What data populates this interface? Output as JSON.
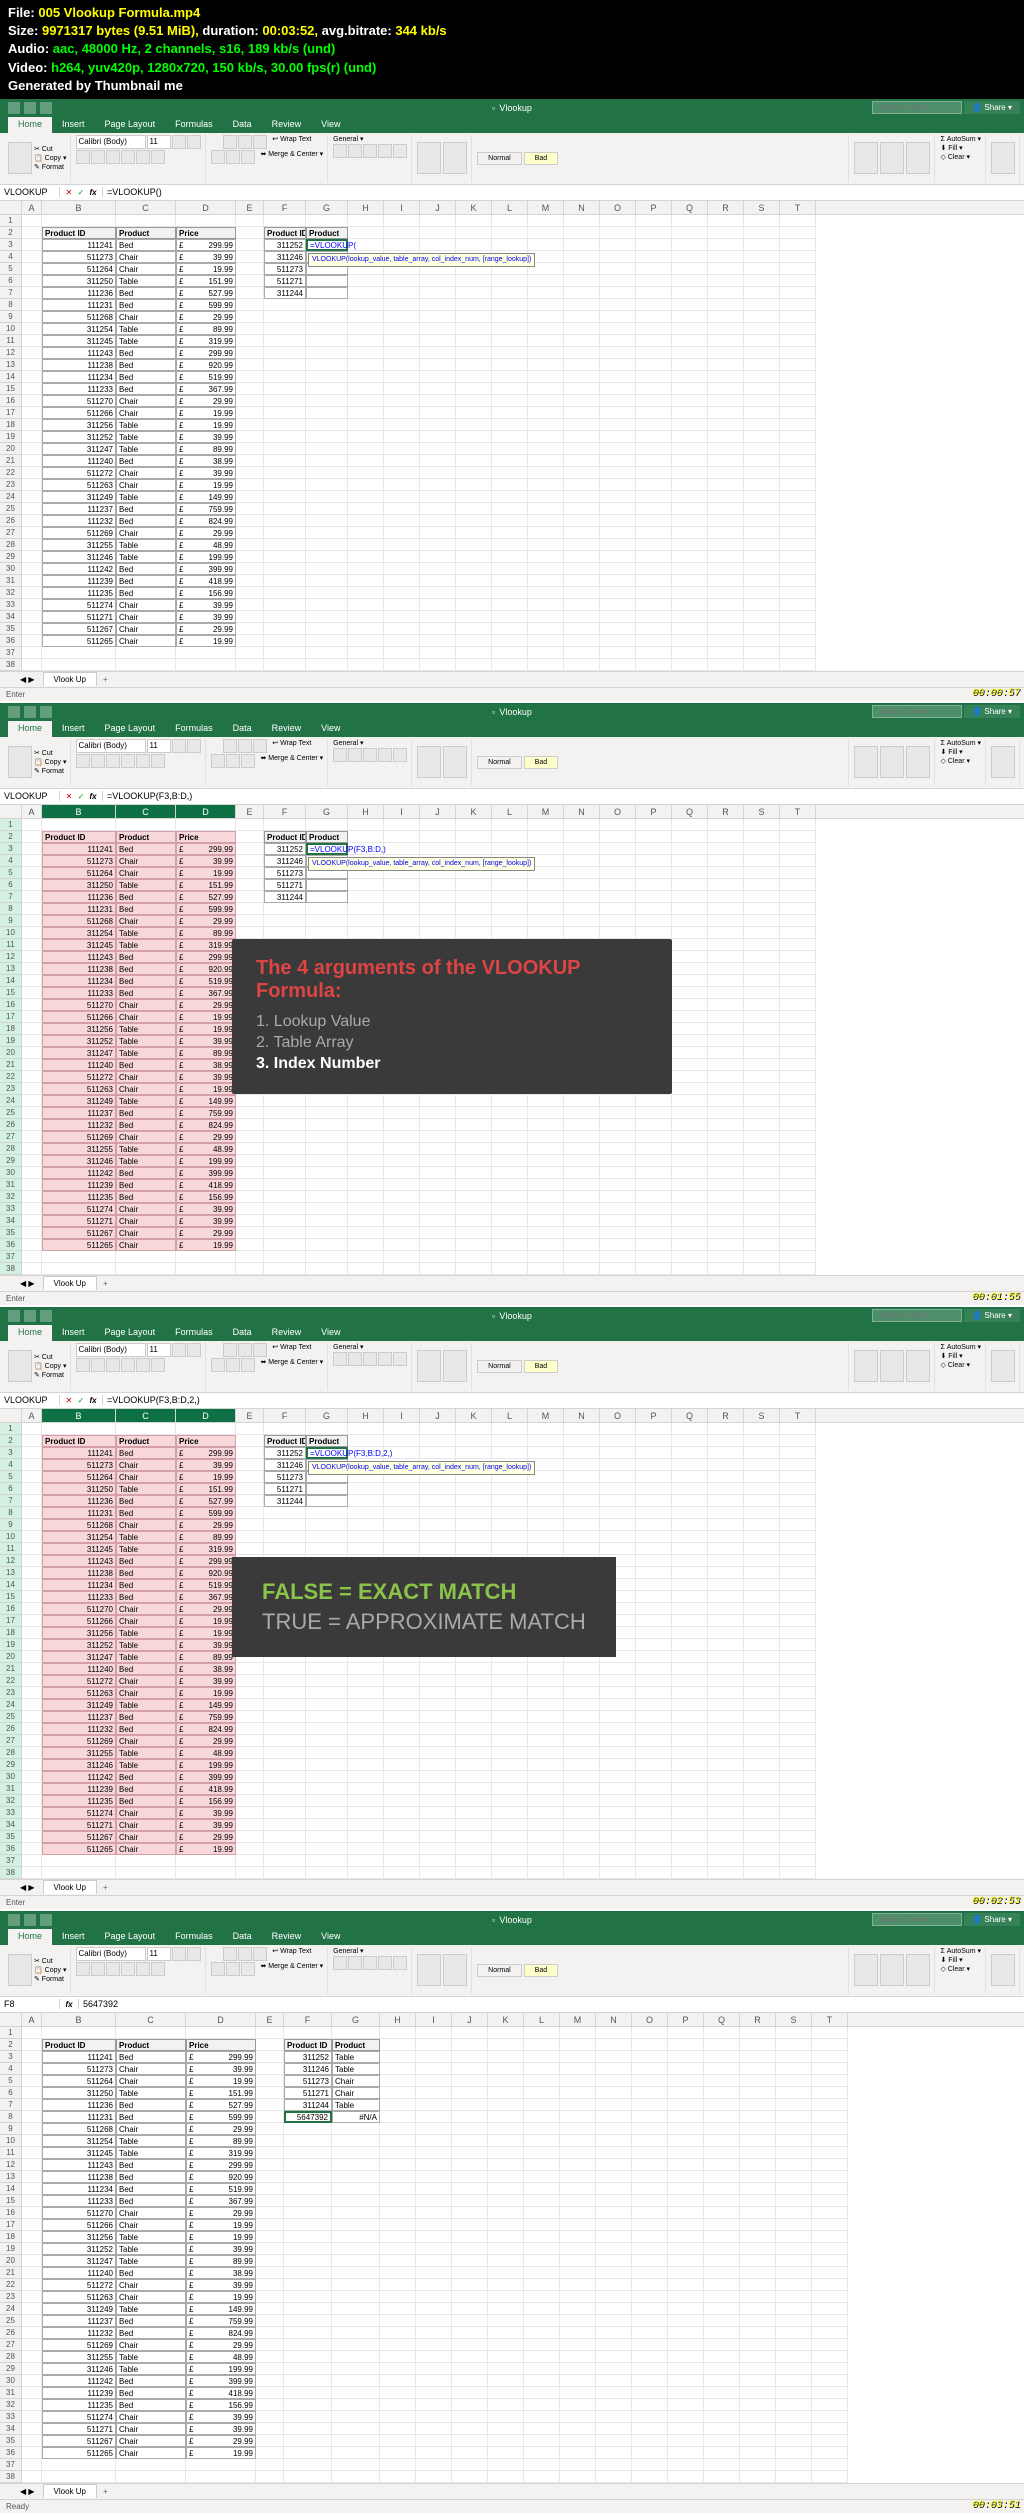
{
  "meta": {
    "file_label": "File:",
    "file": "005 Vlookup Formula.mp4",
    "size_label": "Size:",
    "size": "9971317 bytes (9.51 MiB),",
    "dur_label": "duration:",
    "dur": "00:03:52,",
    "bitrate_label": "avg.bitrate:",
    "bitrate": "344 kb/s",
    "audio_label": "Audio:",
    "audio": "aac, 48000 Hz, 2 channels, s16, 189 kb/s (und)",
    "video_label": "Video:",
    "video": "h264, yuv420p, 1280x720, 150 kb/s, 30.00 fps(r) (und)",
    "gen": "Generated by Thumbnail me"
  },
  "app": {
    "title": "Vlookup",
    "search_placeholder": "Search Sheet",
    "share": "Share",
    "tabs": [
      "Home",
      "Insert",
      "Page Layout",
      "Formulas",
      "Data",
      "Review",
      "View"
    ],
    "font": "Calibri (Body)",
    "size": "11",
    "sheet_tab": "Vlook Up",
    "status_enter": "Enter",
    "status_ready": "Ready",
    "autosum": "AutoSum"
  },
  "cols": {
    "A": 20,
    "B": 74,
    "C": 60,
    "D": 60,
    "E": 28,
    "F": 42,
    "G": 42,
    "def": 36
  },
  "letters": [
    "A",
    "B",
    "C",
    "D",
    "E",
    "F",
    "G",
    "H",
    "I",
    "J",
    "K",
    "L",
    "M",
    "N",
    "O",
    "P",
    "Q",
    "R",
    "S",
    "T"
  ],
  "headers": {
    "pid": "Product ID",
    "prod": "Product",
    "price": "Price"
  },
  "table_data": [
    [
      111241,
      "Bed",
      "£",
      299.99
    ],
    [
      511273,
      "Chair",
      "£",
      39.99
    ],
    [
      511264,
      "Chair",
      "£",
      19.99
    ],
    [
      311250,
      "Table",
      "£",
      151.99
    ],
    [
      111236,
      "Bed",
      "£",
      527.99
    ],
    [
      111231,
      "Bed",
      "£",
      599.99
    ],
    [
      511268,
      "Chair",
      "£",
      29.99
    ],
    [
      311254,
      "Table",
      "£",
      89.99
    ],
    [
      311245,
      "Table",
      "£",
      319.99
    ],
    [
      111243,
      "Bed",
      "£",
      299.99
    ],
    [
      111238,
      "Bed",
      "£",
      920.99
    ],
    [
      111234,
      "Bed",
      "£",
      519.99
    ],
    [
      111233,
      "Bed",
      "£",
      367.99
    ],
    [
      511270,
      "Chair",
      "£",
      29.99
    ],
    [
      511266,
      "Chair",
      "£",
      19.99
    ],
    [
      311256,
      "Table",
      "£",
      19.99
    ],
    [
      311252,
      "Table",
      "£",
      39.99
    ],
    [
      311247,
      "Table",
      "£",
      89.99
    ],
    [
      111240,
      "Bed",
      "£",
      38.99
    ],
    [
      511272,
      "Chair",
      "£",
      39.99
    ],
    [
      511263,
      "Chair",
      "£",
      19.99
    ],
    [
      311249,
      "Table",
      "£",
      149.99
    ],
    [
      111237,
      "Bed",
      "£",
      759.99
    ],
    [
      111232,
      "Bed",
      "£",
      824.99
    ],
    [
      511269,
      "Chair",
      "£",
      29.99
    ],
    [
      311255,
      "Table",
      "£",
      48.99
    ],
    [
      311246,
      "Table",
      "£",
      199.99
    ],
    [
      111242,
      "Bed",
      "£",
      399.99
    ],
    [
      111239,
      "Bed",
      "£",
      418.99
    ],
    [
      111235,
      "Bed",
      "£",
      156.99
    ],
    [
      511274,
      "Chair",
      "£",
      39.99
    ],
    [
      511271,
      "Chair",
      "£",
      39.99
    ],
    [
      511267,
      "Chair",
      "£",
      29.99
    ],
    [
      511265,
      "Chair",
      "£",
      19.99
    ]
  ],
  "lookup_ids": [
    311252,
    311246,
    511273,
    511271,
    311244
  ],
  "screens": {
    "s1": {
      "namebox": "VLOOKUP",
      "formula": "=VLOOKUP()",
      "cell_formula": "=VLOOKUP(",
      "tooltip": "VLOOKUP(lookup_value, table_array, col_index_num, [range_lookup])",
      "ts": "00:00:57",
      "results": []
    },
    "s2": {
      "namebox": "VLOOKUP",
      "formula": "=VLOOKUP(F3,B:D,)",
      "cell_formula": "=VLOOKUP(F3,B:D,)",
      "tooltip": "VLOOKUP(lookup_value, table_array, col_index_num, [range_lookup])",
      "ts": "00:01:55",
      "results": [],
      "overlay": {
        "title": "The 4 arguments of the VLOOKUP Formula:",
        "i1": "1. Lookup Value",
        "i2": "2. Table Array",
        "i3": "3. Index Number"
      }
    },
    "s3": {
      "namebox": "VLOOKUP",
      "formula": "=VLOOKUP(F3,B:D,2,)",
      "cell_formula": "=VLOOKUP(F3,B:D,2,)",
      "tooltip": "VLOOKUP(lookup_value, table_array, col_index_num, [range_lookup])",
      "ts": "00:02:53",
      "results": [],
      "overlay2": {
        "l1": "FALSE = EXACT MATCH",
        "l2": "TRUE = APPROXIMATE  MATCH"
      }
    },
    "s4": {
      "namebox": "F8",
      "formula": "5647392",
      "ts": "00:03:51",
      "results": [
        [
          311252,
          "Table"
        ],
        [
          311246,
          "Table"
        ],
        [
          511273,
          "Chair"
        ],
        [
          511271,
          "Chair"
        ],
        [
          311244,
          "Table"
        ]
      ],
      "extra_lookup": 5647392,
      "na": "#N/A",
      "cols4": {
        "A": 20,
        "B": 74,
        "C": 70,
        "D": 70,
        "E": 28,
        "F": 48,
        "G": 48,
        "def": 36
      }
    }
  }
}
